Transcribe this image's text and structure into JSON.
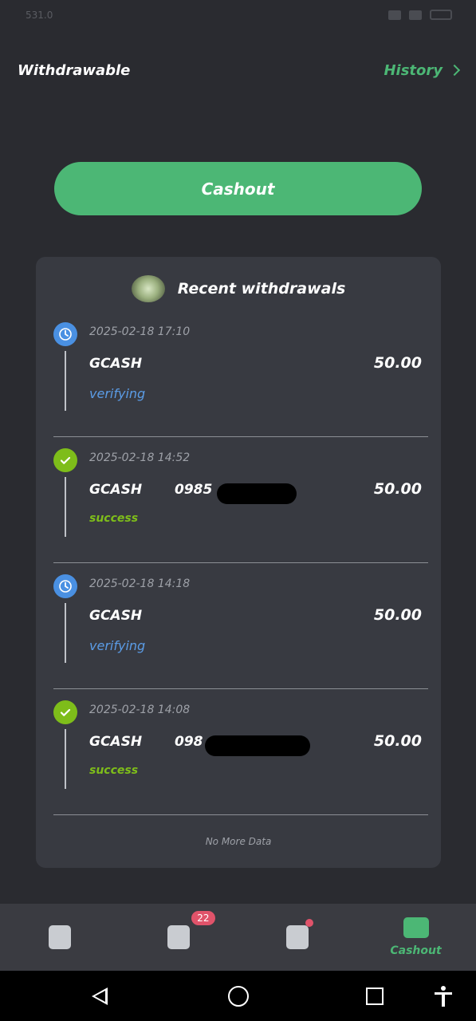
{
  "statusbar": {
    "left_text": "531.0"
  },
  "header": {
    "title": "Withdrawable",
    "history_label": "History"
  },
  "cashout_button": {
    "label": "Cashout"
  },
  "recent": {
    "title": "Recent withdrawals",
    "items": [
      {
        "time": "2025-02-18 17:10",
        "method": "GCASH",
        "account": "",
        "amount": "50.00",
        "status": "verifying",
        "icon": "clock-icon"
      },
      {
        "time": "2025-02-18 14:52",
        "method": "GCASH",
        "account": "0985",
        "amount": "50.00",
        "status": "success",
        "icon": "check-icon"
      },
      {
        "time": "2025-02-18 14:18",
        "method": "GCASH",
        "account": "",
        "amount": "50.00",
        "status": "verifying",
        "icon": "clock-icon"
      },
      {
        "time": "2025-02-18 14:08",
        "method": "GCASH",
        "account": "098",
        "amount": "50.00",
        "status": "success",
        "icon": "check-icon"
      }
    ],
    "no_more": "No More Data"
  },
  "tabbar": {
    "tasks_badge": "22",
    "cashout_label": "Cashout"
  },
  "colors": {
    "background": "#2a2b30",
    "card": "#383a41",
    "accent_green": "#4cb775",
    "verifying_blue": "#5b9ce6",
    "success_green": "#7ebd1a",
    "badge_red": "#e0536a"
  }
}
